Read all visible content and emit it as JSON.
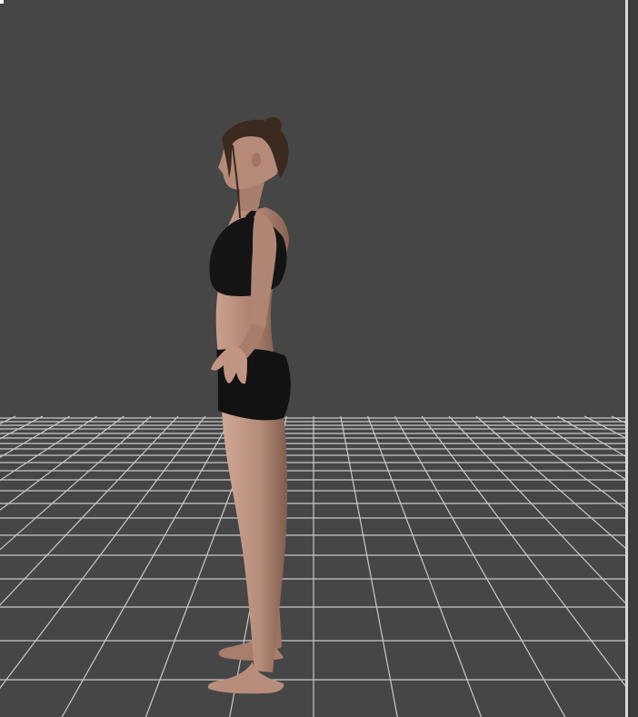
{
  "viewport": {
    "background_color": "#464646",
    "grid_line_color": "#c9c9c9",
    "border_color": "#d8d8d8"
  },
  "figure": {
    "icon": "3d-human-figure-side-view",
    "skin_color": "#b58a78",
    "clothing_color": "#111111",
    "hair_color": "#3b2a20"
  }
}
